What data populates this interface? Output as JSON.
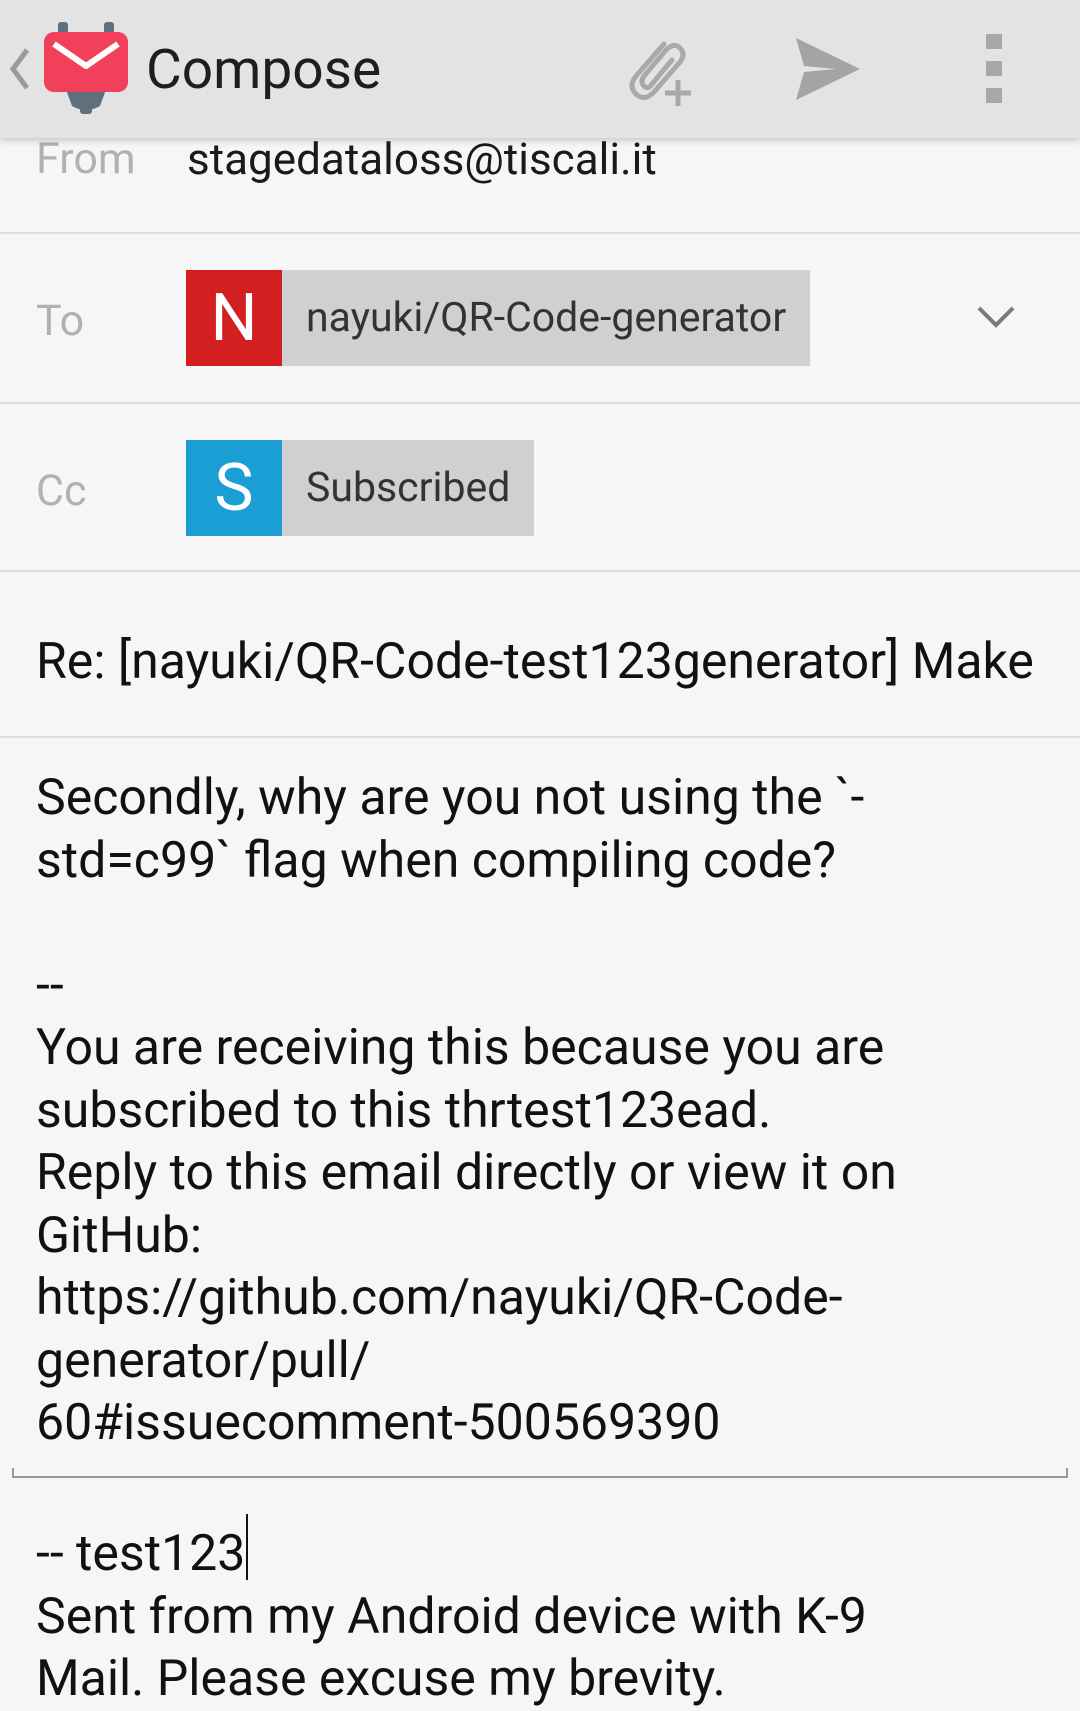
{
  "appbar": {
    "title": "Compose",
    "icons": {
      "back": "chevron-left-icon",
      "app": "k9-mail-icon",
      "attach": "attach-paperclip-add-icon",
      "send": "send-icon",
      "overflow": "overflow-menu-icon"
    },
    "colors": {
      "app_icon": "#f2405b",
      "app_icon_dark": "#5f6f7c"
    }
  },
  "from": {
    "label": "From",
    "value": "stagedataloss@tiscali.it"
  },
  "to": {
    "label": "To",
    "chip": {
      "initial": "N",
      "name": "nayuki/QR-Code-generator",
      "color": "#d21f1f"
    }
  },
  "cc": {
    "label": "Cc",
    "chip": {
      "initial": "S",
      "name": "Subscribed",
      "color": "#1a9ed4"
    }
  },
  "subject": {
    "value": "Re: [nayuki/QR-Code-test123generator] Make"
  },
  "body": {
    "text": "Secondly, why are you not using the `-\nstd=c99` flag when compiling code?\n\n--\nYou are receiving this because you are\nsubscribed to this thrtest123ead.\nReply to this email directly or view it on\nGitHub:\nhttps://github.com/nayuki/QR-Code-\ngenerator/pull/\n60#issuecomment-500569390"
  },
  "signature": {
    "first_line": "-- test123",
    "rest": "Sent from my Android device with K-9\nMail. Please excuse my brevity."
  }
}
